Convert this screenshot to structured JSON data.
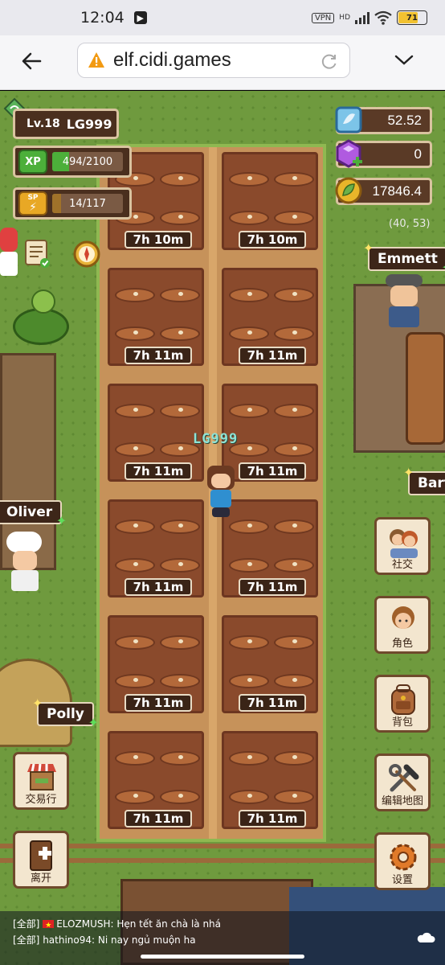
{
  "status_bar": {
    "time": "12:04",
    "vpn": "VPN",
    "network": "HD",
    "battery": "71"
  },
  "browser": {
    "url": "elf.cidi.games"
  },
  "hud": {
    "level": "Lv.18",
    "player_name": "LG999",
    "xp": {
      "badge": "XP",
      "text": "494/2100",
      "current": 494,
      "max": 2100
    },
    "sp": {
      "badge": "SP",
      "text": "14/117",
      "current": 14,
      "max": 117
    },
    "currencies": [
      {
        "name": "gem",
        "value": "52.52",
        "color": "#7cc4e8"
      },
      {
        "name": "crystal",
        "value": "0",
        "color": "#b05ae0"
      },
      {
        "name": "coin",
        "value": "17846.4",
        "color": "#e8b52a"
      }
    ],
    "coordinates": "(40, 53)"
  },
  "farm": {
    "timers": [
      "7h 10m",
      "7h 10m",
      "7h 11m",
      "7h 11m",
      "7h 11m",
      "7h 11m",
      "7h 11m",
      "7h 11m",
      "7h 11m",
      "7h 11m",
      "7h 11m",
      "7h 11m"
    ]
  },
  "player_label": "LG999",
  "npcs": {
    "emmett": "Emmett",
    "bart": "Bart",
    "oliver": "Oliver",
    "polly": "Polly"
  },
  "menu": {
    "social": "社交",
    "character": "角色",
    "backpack": "背包",
    "edit_map": "编辑地图",
    "settings": "设置",
    "market": "交易行",
    "leave": "离开"
  },
  "chat": [
    {
      "channel": "[全部]",
      "user": "ELOZMUSH",
      "message": "Hẹn tết ăn chà là nhá",
      "flag": true
    },
    {
      "channel": "[全部]",
      "user": "hathino94",
      "message": "Ni nay ngủ muộn ha",
      "flag": false
    }
  ],
  "colors": {
    "grass": "#6f9a3e",
    "soil": "#8a4a2c",
    "panel": "#4a2f1e",
    "xp_fill": "#4caf3a",
    "sp_fill": "#e8a825"
  }
}
